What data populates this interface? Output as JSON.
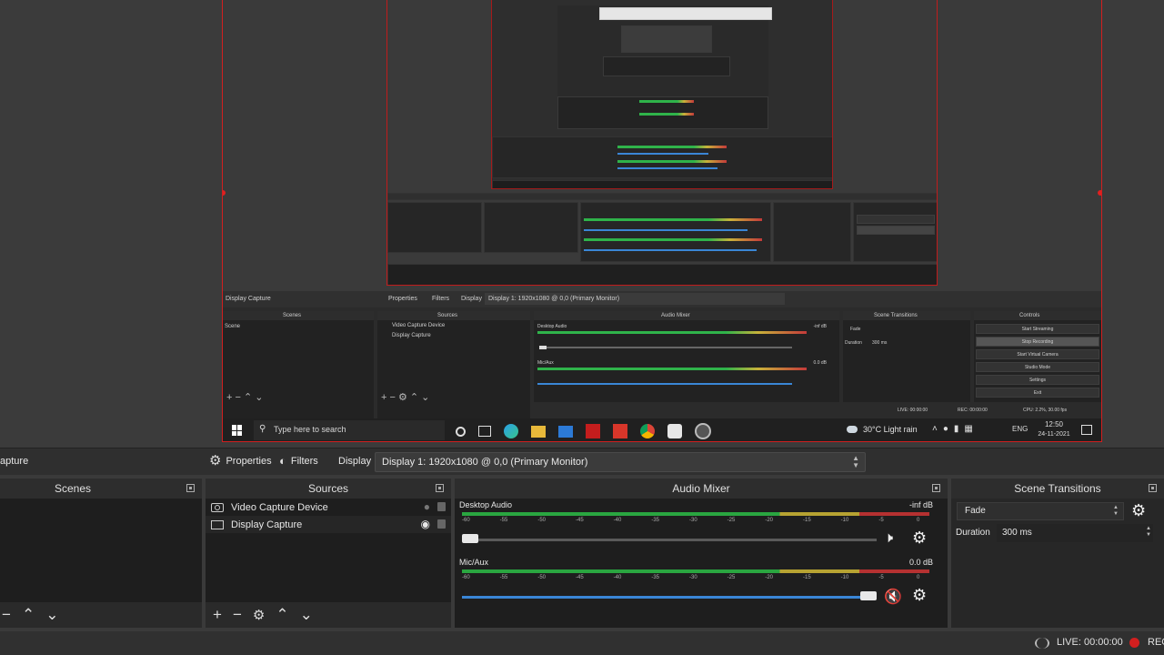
{
  "main": {
    "toolbar": {
      "source_name": "apture",
      "properties_label": "Properties",
      "filters_label": "Filters",
      "display_label": "Display",
      "display_value": "Display 1: 1920x1080 @ 0,0 (Primary Monitor)"
    },
    "scenes": {
      "title": "Scenes"
    },
    "sources": {
      "title": "Sources",
      "items": [
        {
          "label": "Video Capture Device",
          "icon": "camera-icon"
        },
        {
          "label": "Display Capture",
          "icon": "monitor-icon"
        }
      ]
    },
    "mixer": {
      "title": "Audio Mixer",
      "channels": [
        {
          "name": "Desktop Audio",
          "db": "-inf dB",
          "volume": 0.02,
          "muted": false
        },
        {
          "name": "Mic/Aux",
          "db": "0.0 dB",
          "volume": 0.97,
          "muted": true
        }
      ],
      "ticks": [
        "-60",
        "-55",
        "-50",
        "-45",
        "-40",
        "-35",
        "-30",
        "-25",
        "-20",
        "-15",
        "-10",
        "-5",
        "0"
      ]
    },
    "transitions": {
      "title": "Scene Transitions",
      "value": "Fade",
      "duration_label": "Duration",
      "duration_value": "300 ms"
    },
    "status": {
      "live": "LIVE: 00:00:00",
      "rec": "REC"
    },
    "colors": {
      "accent_red": "#d21f1f",
      "meter_green": "#2aa640",
      "meter_yellow": "#b7a332",
      "meter_red": "#b53131",
      "slider_blue": "#3a86d6"
    }
  },
  "embedded": {
    "source_name": "Display Capture",
    "properties_label": "Properties",
    "filters_label": "Filters",
    "display_label": "Display",
    "display_value": "Display 1: 1920x1080 @ 0,0 (Primary Monitor)",
    "scenes_title": "Scenes",
    "scene_item": "Scene",
    "sources_title": "Sources",
    "sources": [
      "Video Capture Device",
      "Display Capture"
    ],
    "mixer_title": "Audio Mixer",
    "channel1": "Desktop Audio",
    "channel1_db": "-inf dB",
    "channel2": "Mic/Aux",
    "channel2_db": "0.0 dB",
    "transitions_title": "Scene Transitions",
    "transition_value": "Fade",
    "duration_label": "Duration",
    "duration_value": "300 ms",
    "controls_title": "Controls",
    "controls": [
      "Start Streaming",
      "Stop Recording",
      "Start Virtual Camera",
      "Studio Mode",
      "Settings",
      "Exit"
    ],
    "status_live": "LIVE: 00:00:00",
    "status_rec": "REC: 00:00:00",
    "status_cpu": "CPU: 2.2%, 30.00 fps",
    "taskbar": {
      "search": "Type here to search",
      "weather": "30°C Light rain",
      "lang": "ENG",
      "time": "12:50",
      "date": "24-11-2021"
    }
  }
}
